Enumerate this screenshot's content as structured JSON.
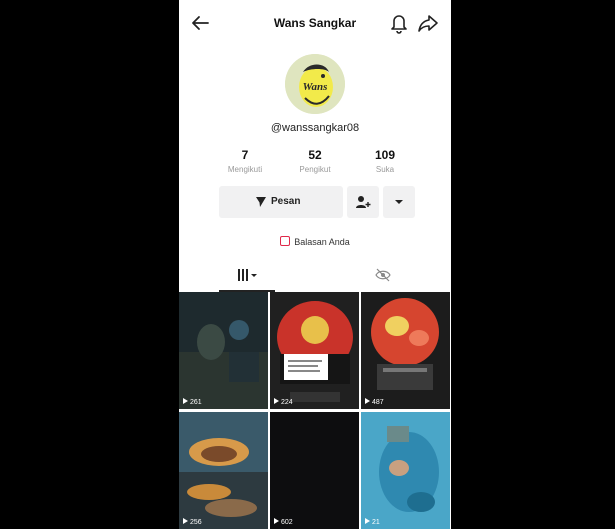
{
  "header": {
    "title": "Wans Sangkar"
  },
  "profile": {
    "username": "@wanssangkar08",
    "avatar_text": "Wans"
  },
  "stats": [
    {
      "value": "7",
      "label": "Mengikuti"
    },
    {
      "value": "52",
      "label": "Pengikut"
    },
    {
      "value": "109",
      "label": "Suka"
    }
  ],
  "actions": {
    "message_label": "Pesan"
  },
  "reply_label": "Balasan Anda",
  "videos": [
    {
      "views": "261"
    },
    {
      "views": "224"
    },
    {
      "views": "487"
    },
    {
      "views": "256"
    },
    {
      "views": "602"
    },
    {
      "views": "21"
    }
  ]
}
